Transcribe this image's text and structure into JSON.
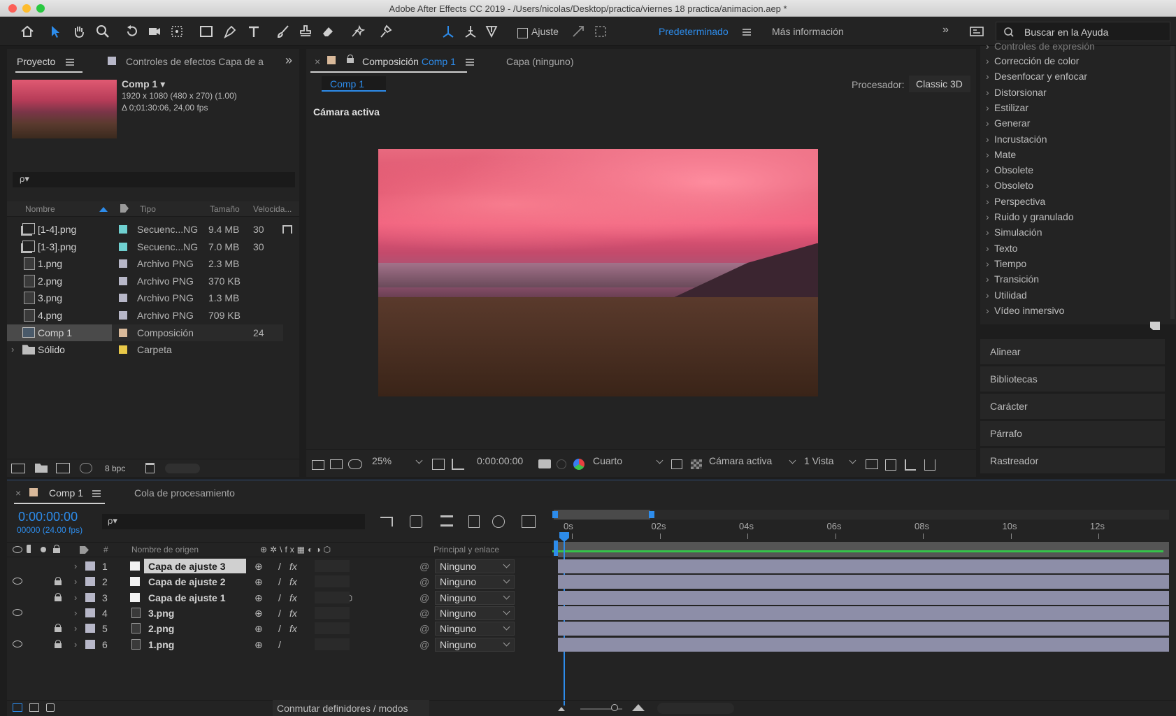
{
  "window": {
    "title": "Adobe After Effects CC 2019 - /Users/nicolas/Desktop/practica/viernes 18 practica/animacion.aep *",
    "traffic_lights": [
      "#fc5f57",
      "#fdbc2e",
      "#28c840"
    ]
  },
  "toolbar": {
    "snap_label": "Ajuste",
    "workspace_label": "Predeterminado",
    "more_info_label": "Más información",
    "search_placeholder": "Buscar en la Ayuda",
    "accent_color": "#2d8ceb"
  },
  "project_panel": {
    "tab_project": "Proyecto",
    "tab_effects_controls": "Controles de efectos Capa de a",
    "comp_name": "Comp 1 ▾",
    "comp_specs": "1920 x 1080  (480 x 270) (1.00)",
    "comp_duration": "Δ 0;01:30:06, 24,00 fps",
    "search_placeholder": "ρ▾",
    "columns": {
      "name": "Nombre",
      "type": "Tipo",
      "size": "Tamaño",
      "speed": "Velocida..."
    },
    "items": [
      {
        "name": "[1-4].png",
        "type": "Secuenc...NG",
        "size": "9.4 MB",
        "speed": "30",
        "label_color": "#6fd0d0",
        "icon": "sequence-icon"
      },
      {
        "name": "[1-3].png",
        "type": "Secuenc...NG",
        "size": "7.0 MB",
        "speed": "30",
        "label_color": "#6fd0d0",
        "icon": "sequence-icon"
      },
      {
        "name": "1.png",
        "type": "Archivo PNG",
        "size": "2.3 MB",
        "speed": "",
        "label_color": "#b7b7c8",
        "icon": "file-icon"
      },
      {
        "name": "2.png",
        "type": "Archivo PNG",
        "size": "370 KB",
        "speed": "",
        "label_color": "#b7b7c8",
        "icon": "file-icon"
      },
      {
        "name": "3.png",
        "type": "Archivo PNG",
        "size": "1.3 MB",
        "speed": "",
        "label_color": "#b7b7c8",
        "icon": "file-icon"
      },
      {
        "name": "4.png",
        "type": "Archivo PNG",
        "size": "709 KB",
        "speed": "",
        "label_color": "#b7b7c8",
        "icon": "file-icon"
      },
      {
        "name": "Comp 1",
        "type": "Composición",
        "size": "",
        "speed": "24",
        "label_color": "#d9b99a",
        "icon": "composition-icon"
      },
      {
        "name": "Sólido",
        "type": "Carpeta",
        "size": "",
        "speed": "",
        "label_color": "#e8c848",
        "icon": "folder-icon"
      }
    ],
    "bpc_label": "8 bpc"
  },
  "viewer": {
    "tab_composition_prefix": "Composición",
    "tab_composition_name": "Comp 1",
    "tab_layer": "Capa (ninguno)",
    "breadcrumb": "Comp 1",
    "renderer_label": "Procesador:",
    "renderer_value": "Classic 3D",
    "camera_label": "Cámara activa",
    "zoom": "25%",
    "timecode": "0:00:00:00",
    "resolution": "Cuarto",
    "view_camera": "Cámara activa",
    "views": "1 Vista"
  },
  "effects_panel": {
    "truncated_top": "Controles de expresión",
    "categories": [
      "Corrección de color",
      "Desenfocar y enfocar",
      "Distorsionar",
      "Estilizar",
      "Generar",
      "Incrustación",
      "Mate",
      "Obsolete",
      "Obsoleto",
      "Perspectiva",
      "Ruido y granulado",
      "Simulación",
      "Texto",
      "Tiempo",
      "Transición",
      "Utilidad",
      "Vídeo inmersivo"
    ]
  },
  "side_panels": [
    "Alinear",
    "Bibliotecas",
    "Carácter",
    "Párrafo",
    "Rastreador"
  ],
  "timeline": {
    "tab_comp": "Comp 1",
    "tab_render_queue": "Cola de procesamiento",
    "timecode": "0:00:00:00",
    "frame_info": "00000 (24.00 fps)",
    "columns": {
      "source_name": "Nombre de origen",
      "number": "#",
      "parent": "Principal y enlace"
    },
    "layers": [
      {
        "num": "1",
        "name": "Capa de ajuste 3",
        "parent": "Ninguno",
        "eye": false,
        "lock": false,
        "solid": true,
        "selected": true
      },
      {
        "num": "2",
        "name": "Capa de ajuste 2",
        "parent": "Ninguno",
        "eye": true,
        "lock": true,
        "solid": true,
        "selected": false
      },
      {
        "num": "3",
        "name": "Capa de ajuste 1",
        "parent": "Ninguno",
        "eye": false,
        "lock": true,
        "solid": true,
        "selected": false
      },
      {
        "num": "4",
        "name": "3.png",
        "parent": "Ninguno",
        "eye": true,
        "lock": false,
        "solid": false,
        "selected": false
      },
      {
        "num": "5",
        "name": "2.png",
        "parent": "Ninguno",
        "eye": false,
        "lock": true,
        "solid": false,
        "selected": false
      },
      {
        "num": "6",
        "name": "1.png",
        "parent": "Ninguno",
        "eye": true,
        "lock": true,
        "solid": false,
        "selected": false
      }
    ],
    "ruler": [
      "0s",
      "02s",
      "04s",
      "06s",
      "08s",
      "10s",
      "12s"
    ],
    "bottom_toggle": "Conmutar definidores / modos",
    "timecode_color": "#2d8ceb"
  }
}
